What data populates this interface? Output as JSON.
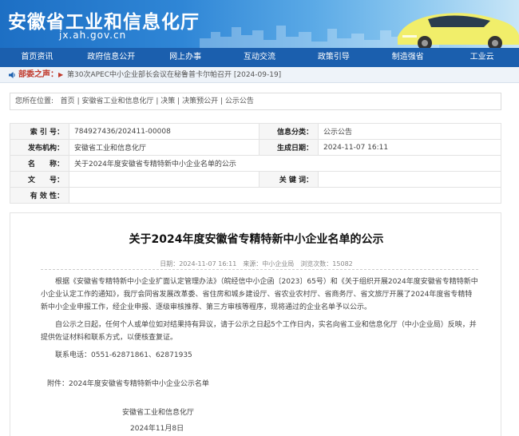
{
  "header": {
    "site_title": "安徽省工业和信息化厅",
    "site_url": "jx.ah.gov.cn"
  },
  "nav": {
    "items": [
      "首页资讯",
      "政府信息公开",
      "网上办事",
      "互动交流",
      "政策引导",
      "制造强省",
      "工业云"
    ]
  },
  "notice": {
    "label": "部委之声：",
    "text": "第30次APEC中小企业部长会议在秘鲁普卡尔帕召开 [2024-09-19]"
  },
  "breadcrumb": {
    "prefix": "您所在位置:",
    "items": [
      "首页",
      "安徽省工业和信息化厅",
      "决策",
      "决策预公开",
      "公示公告"
    ]
  },
  "info": {
    "index_label": "索 引 号：",
    "index_value": "784927436/202411-00008",
    "category_label": "信息分类：",
    "category_value": "公示公告",
    "publisher_label": "发布机构：",
    "publisher_value": "安徽省工业和信息化厅",
    "date_label": "生成日期：",
    "date_value": "2024-11-07 16:11",
    "name_label": "名　　称：",
    "name_value": "关于2024年度安徽省专精特新中小企业名单的公示",
    "doc_label": "文　　号：",
    "doc_value": "",
    "keyword_label": "关 键 词：",
    "keyword_value": "",
    "valid_label": "有 效 性：",
    "valid_value": ""
  },
  "article": {
    "title": "关于2024年度安徽省专精特新中小企业名单的公示",
    "meta": "日期：2024-11-07 16:11　来源：中小企业局　浏览次数：15082",
    "para1": "根据《安徽省专精特新中小企业扩面认定管理办法》（皖经信中小企函〔2023〕65号）和《关于组织开展2024年度安徽省专精特新中小企业认定工作的通知》，我厅会同省发展改革委、省住房和城乡建设厅、省农业农村厅、省商务厅、省文旅厅开展了2024年度省专精特新中小企业申报工作，经企业申报、逐级审核推荐、第三方审核等程序，现将通过的企业名单予以公示。",
    "para2": "自公示之日起，任何个人或单位如对结果持有异议，请于公示之日起5个工作日内，实名向省工业和信息化厅（中小企业局）反映，并提供佐证材料和联系方式，以便核查复证。",
    "contact": "联系电话：0551-62871861、62871935",
    "attachment": "附件：2024年度安徽省专精特新中小企业公示名单",
    "signature": "安徽省工业和信息化厅",
    "sign_date": "2024年11月8日"
  }
}
